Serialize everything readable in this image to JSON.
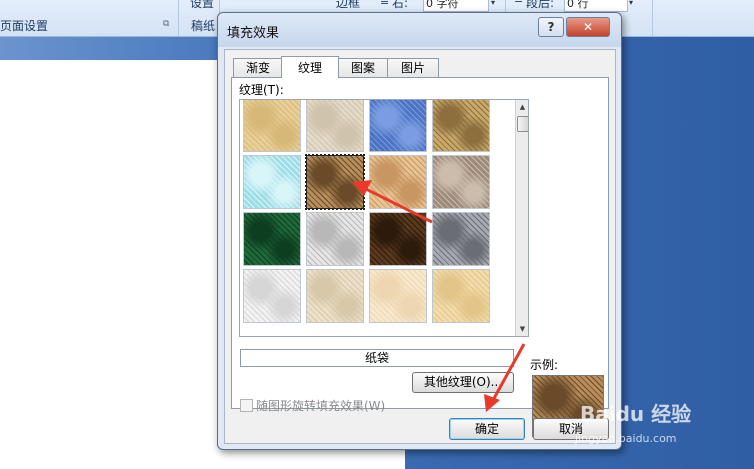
{
  "ribbon": {
    "left_group_label": "页面设置",
    "setup_label": "设置",
    "paper_label": "稿纸",
    "border_label": "边框",
    "indent_right_label": "右:",
    "indent_right_value": "0 字符",
    "spacing_after_label": "段后:",
    "spacing_after_value": "0 行"
  },
  "dialog": {
    "title": "填充效果",
    "help_label": "?",
    "close_label": "✕",
    "tabs": [
      {
        "label": "渐变",
        "active": false
      },
      {
        "label": "纹理",
        "active": true
      },
      {
        "label": "图案",
        "active": false
      },
      {
        "label": "图片",
        "active": false
      }
    ],
    "texture_label": "纹理(T):",
    "textures": [
      {
        "icon": "papyrus-texture",
        "color": "#e8cf98",
        "color2": "#d8b878"
      },
      {
        "icon": "canvas-texture",
        "color": "#e4dac8",
        "color2": "#cfc3ac"
      },
      {
        "icon": "denim-texture",
        "color": "#4b73c2",
        "color2": "#7b9ce0"
      },
      {
        "icon": "woven-mat-texture",
        "color": "#c9a96a",
        "color2": "#8d6f3e"
      },
      {
        "icon": "water-droplets-texture",
        "color": "#9fdde6",
        "color2": "#d8f5f8"
      },
      {
        "icon": "paper-bag-texture",
        "color": "#b78e5c",
        "color2": "#6a4a28"
      },
      {
        "icon": "fish-fossil-texture",
        "color": "#e8c494",
        "color2": "#c79662"
      },
      {
        "icon": "sand-texture",
        "color": "#9c8a7a",
        "color2": "#cbbcac"
      },
      {
        "icon": "green-marble-texture",
        "color": "#1f6a3a",
        "color2": "#0e3e20"
      },
      {
        "icon": "white-marble-texture",
        "color": "#e6e6e6",
        "color2": "#b8b8b8"
      },
      {
        "icon": "brown-marble-texture",
        "color": "#5a3a1e",
        "color2": "#2c1a0a"
      },
      {
        "icon": "granite-texture",
        "color": "#a8aab2",
        "color2": "#6b6d75"
      },
      {
        "icon": "newsprint-texture",
        "color": "#f2f2f2",
        "color2": "#d6d6d6"
      },
      {
        "icon": "recycled-paper-texture",
        "color": "#ece0c8",
        "color2": "#d7c8aa"
      },
      {
        "icon": "parchment-texture",
        "color": "#f8e8cc",
        "color2": "#edd6b0"
      },
      {
        "icon": "stationery-texture",
        "color": "#f2dcaa",
        "color2": "#e3c58a"
      }
    ],
    "selected_index": 5,
    "selected_name": "纸袋",
    "more_textures_label": "其他纹理(O)...",
    "rotate_checkbox_label": "随图形旋转填充效果(W)",
    "rotate_checked": false,
    "sample_label": "示例:",
    "ok_label": "确定",
    "cancel_label": "取消"
  },
  "watermark": {
    "brand": "Baidu 经验",
    "url": "jingyan.baidu.com"
  },
  "colors": {
    "arrow": "#e8392b",
    "accent": "#3c7fb1"
  }
}
